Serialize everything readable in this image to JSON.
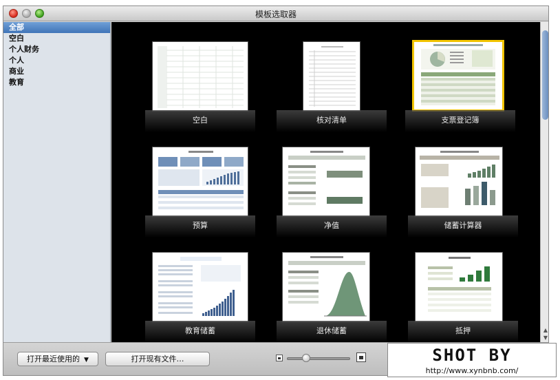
{
  "window": {
    "title": "模板选取器"
  },
  "sidebar": {
    "items": [
      {
        "label": "全部",
        "selected": true
      },
      {
        "label": "空白",
        "selected": false
      },
      {
        "label": "个人财务",
        "selected": false
      },
      {
        "label": "个人",
        "selected": false
      },
      {
        "label": "商业",
        "selected": false
      },
      {
        "label": "教育",
        "selected": false
      }
    ]
  },
  "templates": [
    {
      "label": "空白",
      "selected": false
    },
    {
      "label": "核对清单",
      "selected": false
    },
    {
      "label": "支票登记簿",
      "selected": true
    },
    {
      "label": "预算",
      "selected": false
    },
    {
      "label": "净值",
      "selected": false
    },
    {
      "label": "储蓄计算器",
      "selected": false
    },
    {
      "label": "教育储蓄",
      "selected": false
    },
    {
      "label": "退休储蓄",
      "selected": false
    },
    {
      "label": "抵押",
      "selected": false
    }
  ],
  "bottombar": {
    "recent_label": "打开最近使用的",
    "open_existing_label": "打开现有文件…",
    "zoom_level": 0.25
  },
  "watermark": {
    "title": "SHOT BY",
    "url": "http://www.xynbnb.com/"
  },
  "colors": {
    "selection_border": "#f2c400",
    "sidebar_selection": "#3f74b8",
    "thumb_accent": "#8aa87a"
  }
}
